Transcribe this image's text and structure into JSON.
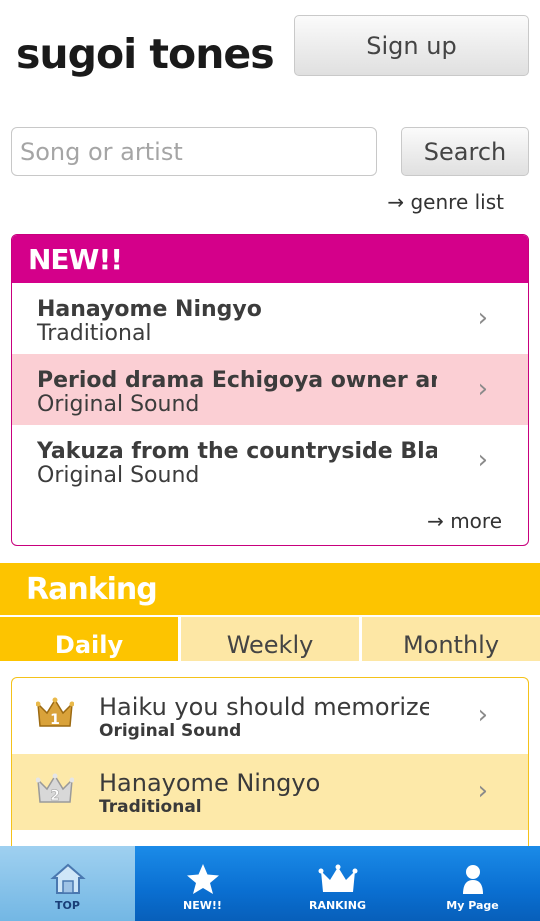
{
  "header": {
    "logo": "sugoi tones",
    "signup_label": "Sign up"
  },
  "search": {
    "placeholder": "Song or artist",
    "button_label": "Search",
    "genre_link": "→ genre list"
  },
  "new_section": {
    "title": "NEW!!",
    "items": [
      {
        "title": "Hanayome Ningyo",
        "artist": "Traditional"
      },
      {
        "title": "Period drama Echigoya owner an…",
        "artist": "Original Sound"
      },
      {
        "title": "Yakuza from the countryside Blac…",
        "artist": "Original Sound"
      }
    ],
    "more_link": "→ more"
  },
  "ranking": {
    "title": "Ranking",
    "tabs": [
      {
        "label": "Daily"
      },
      {
        "label": "Weekly"
      },
      {
        "label": "Monthly"
      }
    ],
    "items": [
      {
        "rank": "1",
        "title": "Haiku you should memorize…",
        "artist": "Original Sound"
      },
      {
        "rank": "2",
        "title": "Hanayome Ningyo",
        "artist": "Traditional"
      }
    ]
  },
  "tabbar": [
    {
      "label": "TOP",
      "icon": "home-icon"
    },
    {
      "label": "NEW!!",
      "icon": "star-icon"
    },
    {
      "label": "RANKING",
      "icon": "crown-icon"
    },
    {
      "label": "My Page",
      "icon": "person-icon"
    }
  ],
  "colors": {
    "new_accent": "#d4008a",
    "new_highlight": "#fbcfd4",
    "ranking_accent": "#fdc400",
    "ranking_alt": "#fde9a9",
    "tabbar": "#0a6fd1"
  }
}
